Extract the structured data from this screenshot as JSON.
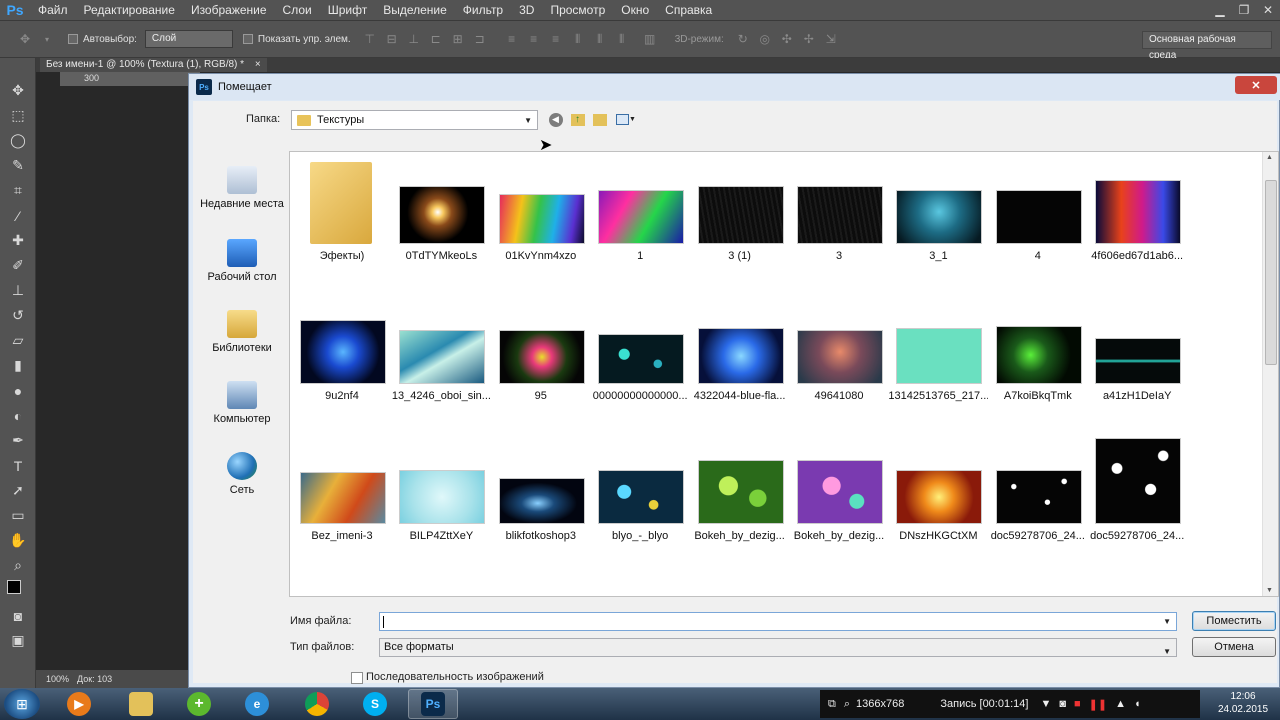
{
  "app": {
    "logo": "Ps",
    "menu": [
      "Файл",
      "Редактирование",
      "Изображение",
      "Слои",
      "Шрифт",
      "Выделение",
      "Фильтр",
      "3D",
      "Просмотр",
      "Окно",
      "Справка"
    ]
  },
  "options_bar": {
    "autoselect_label": "Автовыбор:",
    "autoselect_value": "Слой",
    "show_transform_label": "Показать упр. элем.",
    "mode3d_label": "3D-режим:",
    "workspace": "Основная рабочая среда"
  },
  "document": {
    "tab_title": "Без имени-1 @ 100% (Textura (1), RGB/8) *",
    "tab_close": "×",
    "ruler_mark": "300",
    "zoom": "100%",
    "doc_info": "Док: 103"
  },
  "dialog": {
    "title": "Помещает",
    "close": "✕",
    "folder_label": "Папка:",
    "folder_value": "Текстуры",
    "places": [
      {
        "label": "Недавние места"
      },
      {
        "label": "Рабочий стол"
      },
      {
        "label": "Библиотеки"
      },
      {
        "label": "Компьютер"
      },
      {
        "label": "Сеть"
      }
    ],
    "files": [
      {
        "name": "Эфекты)",
        "kind": "folder"
      },
      {
        "name": "0TdTYMkeoLs",
        "kind": "spark"
      },
      {
        "name": "01KvYnm4xzo",
        "kind": "rainbow"
      },
      {
        "name": "1",
        "kind": "colorblur"
      },
      {
        "name": "3 (1)",
        "kind": "darkscratch"
      },
      {
        "name": "3",
        "kind": "darkscratch"
      },
      {
        "name": "3_1",
        "kind": "teal"
      },
      {
        "name": "4",
        "kind": "black"
      },
      {
        "name": "4f606ed67d1ab6...",
        "kind": "smokecolor"
      },
      {
        "name": "9u2nf4",
        "kind": "bluesmoke"
      },
      {
        "name": "13_4246_oboi_sin...",
        "kind": "bluestreak"
      },
      {
        "name": "95",
        "kind": "neonlines"
      },
      {
        "name": "00000000000000...",
        "kind": "tealbokeh"
      },
      {
        "name": "4322044-blue-fla...",
        "kind": "blueflame"
      },
      {
        "name": "49641080",
        "kind": "warmbokeh"
      },
      {
        "name": "13142513765_217...",
        "kind": "mint"
      },
      {
        "name": "A7koiBkqTmk",
        "kind": "greenlines"
      },
      {
        "name": "a41zH1DeIaY",
        "kind": "pulse"
      },
      {
        "name": "Bez_imeni-3",
        "kind": "blurwarm"
      },
      {
        "name": "BILP4ZttXeY",
        "kind": "iceblue"
      },
      {
        "name": "blikfotkoshop3",
        "kind": "flare"
      },
      {
        "name": "blyo_-_blyo",
        "kind": "bluebokeh"
      },
      {
        "name": "Bokeh_by_dezig...",
        "kind": "greenbokeh"
      },
      {
        "name": "Bokeh_by_dezig...",
        "kind": "pinkbokeh"
      },
      {
        "name": "DNszHKGCtXM",
        "kind": "fire"
      },
      {
        "name": "doc59278706_24...",
        "kind": "snow"
      },
      {
        "name": "doc59278706_24...",
        "kind": "snowbig"
      }
    ],
    "filename_label": "Имя файла:",
    "filename_value": "",
    "filetype_label": "Тип файлов:",
    "filetype_value": "Все форматы",
    "place_button": "Поместить",
    "cancel_button": "Отмена",
    "sequence_label": "Последовательность изображений"
  },
  "taskbar": {
    "resolution": "1366x768",
    "recording": "Запись [00:01:14]",
    "time": "12:06",
    "date": "24.02.2015"
  },
  "colors": {
    "ps_blue": "#3fa7ff",
    "dialog_bg": "#f0f0f0",
    "close_red": "#c9463d"
  }
}
